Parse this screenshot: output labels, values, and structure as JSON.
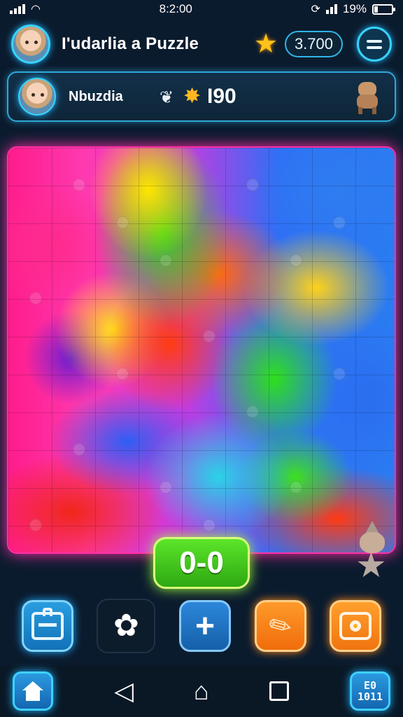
{
  "status_bar": {
    "time": "8:2:00",
    "battery": "19%"
  },
  "header": {
    "title": "I'udarlia a Puzzle",
    "coins": "3.700"
  },
  "player_card": {
    "name": "Nbuzdia",
    "score": "I90"
  },
  "game": {
    "score_badge": "0-0"
  },
  "icons": {
    "avatar": "avatar-girl",
    "star": "star-icon",
    "menu": "menu-icon",
    "feather": "feather-icon",
    "puzzle": "puzzle-piece-icon",
    "inventory": "toolbox-icon",
    "piece": "puzzle-piece-outline-icon",
    "add": "plus-icon",
    "hint": "pencil-icon",
    "shop": "shop-bag-icon",
    "home": "home-icon",
    "back": "back-icon",
    "recent": "square-icon",
    "grid": "grid-icon"
  },
  "colors": {
    "accent_cyan": "#2fb6e6",
    "board_glow": "#ff2fa6",
    "score_green": "#3cc41a",
    "orange": "#f07410"
  },
  "nav": {
    "grid_label": "E0\n1011"
  }
}
